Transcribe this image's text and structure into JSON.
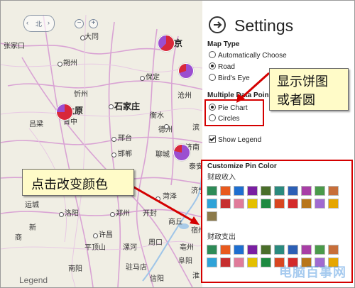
{
  "map": {
    "cities": [
      {
        "name": "大同"
      },
      {
        "name": "北京"
      },
      {
        "name": "张家口"
      },
      {
        "name": "朔州"
      },
      {
        "name": "保定"
      },
      {
        "name": "忻州"
      },
      {
        "name": "沧州"
      },
      {
        "name": "太原"
      },
      {
        "name": "石家庄"
      },
      {
        "name": "衡水"
      },
      {
        "name": "吕梁"
      },
      {
        "name": "晋中"
      },
      {
        "name": "德州"
      },
      {
        "name": "滨"
      },
      {
        "name": "邢台"
      },
      {
        "name": "邯郸"
      },
      {
        "name": "聊城"
      },
      {
        "name": "济南"
      },
      {
        "name": "泰安"
      },
      {
        "name": "菏泽"
      },
      {
        "name": "济宁"
      },
      {
        "name": "运城"
      },
      {
        "name": "洛阳"
      },
      {
        "name": "郑州"
      },
      {
        "name": "开封"
      },
      {
        "name": "许昌"
      },
      {
        "name": "周口"
      },
      {
        "name": "平顶山"
      },
      {
        "name": "漯河"
      },
      {
        "name": "驻马店"
      },
      {
        "name": "南阳"
      },
      {
        "name": "商丘"
      },
      {
        "name": "阜阳"
      },
      {
        "name": "宿州"
      },
      {
        "name": "亳州"
      },
      {
        "name": "商"
      },
      {
        "name": "新"
      },
      {
        "name": "信阳"
      },
      {
        "name": "淮"
      }
    ],
    "legend_label": "Legend",
    "nav_glyph": "北",
    "zoom_out": "−",
    "zoom_in": "+"
  },
  "settings": {
    "title": "Settings",
    "map_type_label": "Map Type",
    "map_type_options": [
      "Automatically Choose",
      "Road",
      "Bird's Eye"
    ],
    "map_type_selected": "Road",
    "data_point_label": "Multiple Data Points",
    "data_point_options": [
      "Pie Chart",
      "Circles"
    ],
    "data_point_selected": "Pie Chart",
    "show_legend_label": "Show Legend",
    "show_legend_checked": true,
    "pin_color_label": "Customize Pin Color",
    "groups": [
      {
        "label": "财政收入",
        "colors": [
          "#2e8b57",
          "#e85a1e",
          "#1e6fd0",
          "#7a1fa2",
          "#4a6e2a",
          "#2a8a7e",
          "#2c5fb5",
          "#a83ea6",
          "#4a9a4a",
          "#c76e3a",
          "#2fa3d8",
          "#c62f2f",
          "#e07b9a",
          "#e4c000",
          "#1d8a40",
          "#d84620",
          "#d42a2a",
          "#b8761a",
          "#a06ad0",
          "#e6a600",
          "#8c7a4a"
        ]
      },
      {
        "label": "财政支出",
        "colors": [
          "#2e8b57",
          "#e85a1e",
          "#1e6fd0",
          "#7a1fa2",
          "#4a6e2a",
          "#2a8a7e",
          "#2c5fb5",
          "#a83ea6",
          "#4a9a4a",
          "#c76e3a",
          "#2fa3d8",
          "#c62f2f",
          "#e07b9a",
          "#e4c000",
          "#1d8a40",
          "#d84620",
          "#d42a2a",
          "#b8761a",
          "#a06ad0",
          "#e6a600"
        ]
      }
    ]
  },
  "callouts": {
    "pie_hint": [
      "显示饼图",
      "或者圆"
    ],
    "color_hint": "点击改变颜色"
  },
  "watermark": "电脑百事网",
  "colors": {
    "callout_bg": "#fffbc8",
    "highlight_red": "#d40000",
    "pie_red": "#d8283a",
    "pie_purple": "#9b4ed0"
  }
}
